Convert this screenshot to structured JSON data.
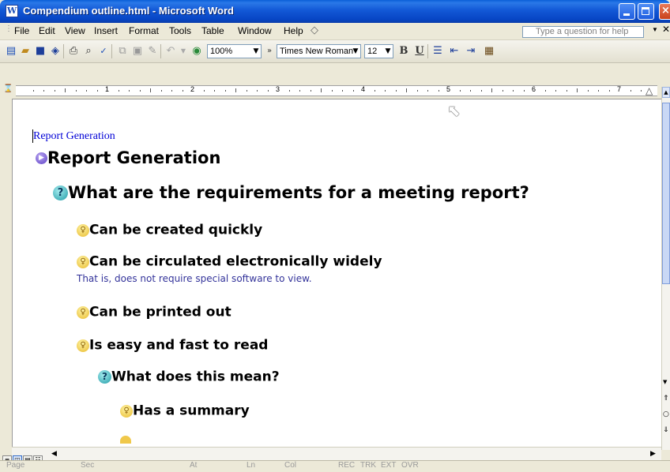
{
  "window": {
    "title": "Compendium outline.html - Microsoft Word"
  },
  "menu": {
    "items": [
      "File",
      "Edit",
      "View",
      "Insert",
      "Format",
      "Tools",
      "Table",
      "Window",
      "Help"
    ],
    "help_placeholder": "Type a question for help"
  },
  "toolbar": {
    "zoom": "100%",
    "font": "Times New Roman",
    "size": "12",
    "bold": "B",
    "underline": "U"
  },
  "ruler": {
    "numbers": [
      "1",
      "2",
      "3",
      "4",
      "5",
      "6",
      "7"
    ]
  },
  "document": {
    "link_text": "Report Generation",
    "outline": [
      {
        "icon": "map-icon",
        "text": "Report Generation",
        "level": 0
      },
      {
        "icon": "question-icon",
        "text": "What are the requirements for a meeting report?",
        "level": 1
      },
      {
        "icon": "idea-icon",
        "text": "Can be created quickly",
        "level": 2
      },
      {
        "icon": "idea-icon",
        "text": "Can be circulated electronically widely",
        "level": 2,
        "note": "That is, does not require special software to view."
      },
      {
        "icon": "idea-icon",
        "text": "Can be printed out",
        "level": 2
      },
      {
        "icon": "idea-icon",
        "text": "Is easy and fast to read",
        "level": 2
      },
      {
        "icon": "question-icon",
        "text": "What does this mean?",
        "level": 3
      },
      {
        "icon": "idea-icon",
        "text": "Has a summary",
        "level": 4
      }
    ]
  },
  "statusbar": {
    "page": "Page",
    "sec": "Sec",
    "at": "At",
    "ln": "Ln",
    "col": "Col",
    "rec": "REC",
    "trk": "TRK",
    "ext": "EXT",
    "ovr": "OVR"
  },
  "colors": {
    "titlebar": "#0A5FD8",
    "chrome": "#ECE9D8",
    "link": "#0000D6",
    "note": "#33339A"
  }
}
